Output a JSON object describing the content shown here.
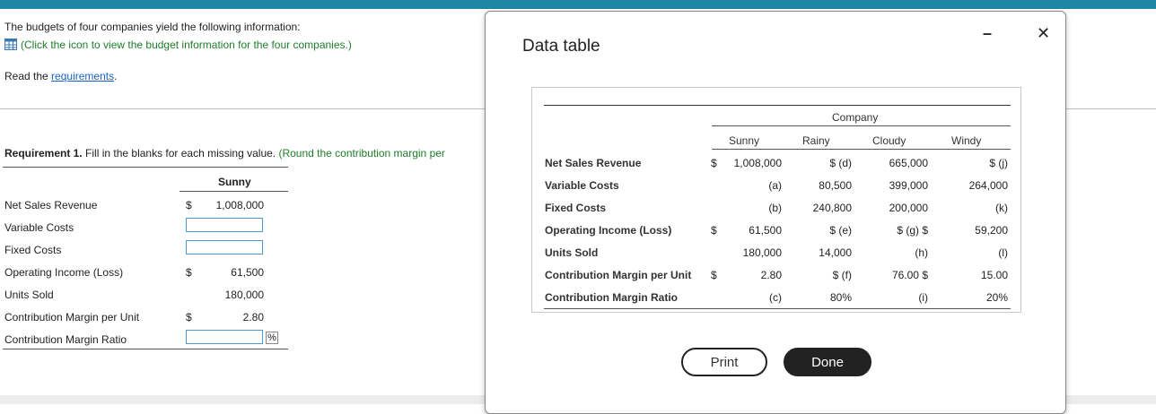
{
  "intro": {
    "line1": "The budgets of four companies yield the following information:",
    "icon_link": "(Click the icon to view the budget information for the four companies.)",
    "read_prefix": "Read the ",
    "read_link": "requirements",
    "read_suffix": "."
  },
  "requirement": {
    "label": "Requirement 1.",
    "text": " Fill in the blanks for each missing value.",
    "hint": " (Round the contribution margin per"
  },
  "worksheet": {
    "column_header": "Sunny",
    "rows": [
      {
        "label": "Net Sales Revenue",
        "dollar": "$",
        "value": "1,008,000"
      },
      {
        "label": "Variable Costs",
        "dollar": "",
        "value": ""
      },
      {
        "label": "Fixed Costs",
        "dollar": "",
        "value": ""
      },
      {
        "label": "Operating Income (Loss)",
        "dollar": "$",
        "value": "61,500"
      },
      {
        "label": "Units Sold",
        "dollar": "",
        "value": "180,000"
      },
      {
        "label": "Contribution Margin per Unit",
        "dollar": "$",
        "value": "2.80"
      },
      {
        "label": "Contribution Margin Ratio",
        "dollar": "",
        "value": "",
        "suffix": "%"
      }
    ]
  },
  "modal": {
    "title": "Data table",
    "minimize": "–",
    "close": "✕",
    "group_header": "Company",
    "columns": [
      "Sunny",
      "Rainy",
      "Cloudy",
      "Windy"
    ],
    "rows": [
      {
        "label": "Net Sales Revenue",
        "cells": [
          "$",
          "1,008,000",
          "$ (d)",
          "$",
          "665,000",
          "$ (j)"
        ]
      },
      {
        "label": "Variable Costs",
        "cells": [
          "",
          "(a)",
          "80,500",
          "",
          "399,000",
          "264,000"
        ]
      },
      {
        "label": "Fixed Costs",
        "cells": [
          "",
          "(b)",
          "240,800",
          "",
          "200,000",
          "(k)"
        ]
      },
      {
        "label": "Operating Income (Loss)",
        "cells": [
          "$",
          "61,500",
          "$ (e)",
          "",
          "$ (g) $",
          "59,200"
        ]
      },
      {
        "label": "Units Sold",
        "cells": [
          "",
          "180,000",
          "14,000",
          "",
          "(h)",
          "(l)"
        ]
      },
      {
        "label": "Contribution Margin per Unit",
        "cells": [
          "$",
          "2.80",
          "$ (f)",
          "$",
          "76.00 $",
          "15.00"
        ]
      },
      {
        "label": "Contribution Margin Ratio",
        "cells": [
          "",
          "(c)",
          "80%",
          "",
          "(i)",
          "20%"
        ]
      }
    ],
    "print_label": "Print",
    "done_label": "Done"
  }
}
